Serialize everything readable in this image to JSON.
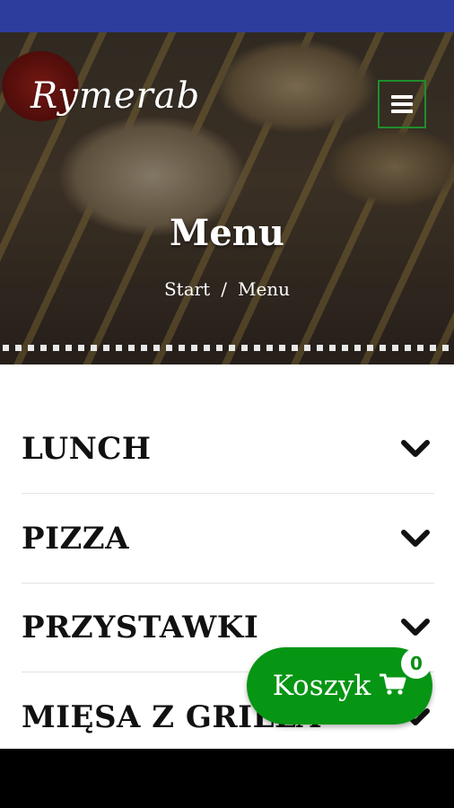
{
  "brand": {
    "logo_text": "Rymerab",
    "accent": "#079514",
    "status_bar_color": "#2d3d9e"
  },
  "hero": {
    "title": "Menu",
    "breadcrumb": {
      "home": "Start",
      "separator": "/",
      "current": "Menu"
    }
  },
  "menu_toggle": {
    "icon": "hamburger-icon"
  },
  "categories": [
    {
      "label": "LUNCH",
      "icon": "chevron-down-icon"
    },
    {
      "label": "PIZZA",
      "icon": "chevron-down-icon"
    },
    {
      "label": "PRZYSTAWKI",
      "icon": "chevron-down-icon"
    },
    {
      "label": "MIĘSA Z GRILLA",
      "icon": "chevron-down-icon"
    }
  ],
  "cart": {
    "label": "Koszyk",
    "icon": "cart-icon",
    "count": "0"
  }
}
